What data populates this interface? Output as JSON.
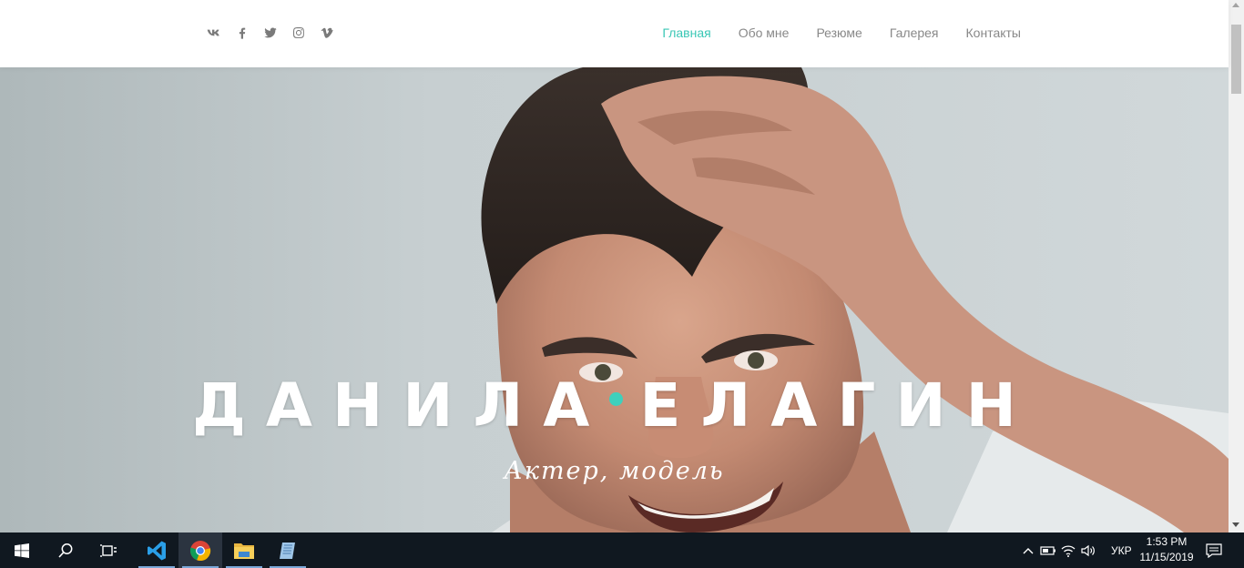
{
  "header": {
    "socials": [
      {
        "icon": "vk-icon",
        "label": "vk"
      },
      {
        "icon": "facebook-icon",
        "label": "f"
      },
      {
        "icon": "twitter-icon",
        "label": "twitter"
      },
      {
        "icon": "instagram-icon",
        "label": "instagram"
      },
      {
        "icon": "vimeo-icon",
        "label": "vimeo"
      }
    ],
    "nav": [
      {
        "label": "Главная",
        "active": true
      },
      {
        "label": "Обо мне",
        "active": false
      },
      {
        "label": "Резюме",
        "active": false
      },
      {
        "label": "Галерея",
        "active": false
      },
      {
        "label": "Контакты",
        "active": false
      }
    ]
  },
  "hero": {
    "first_name": "ДАНИЛА",
    "last_name": "ЕЛАГИН",
    "subtitle": "Актер, модель"
  },
  "colors": {
    "accent": "#3ac7b5",
    "nav_text": "#888888",
    "taskbar": "#101820"
  },
  "taskbar": {
    "apps": [
      "start-icon",
      "search-icon",
      "task-view-icon",
      "vscode-icon",
      "chrome-icon",
      "file-explorer-icon",
      "notepad-icon"
    ],
    "language": "УКР",
    "time": "1:53 PM",
    "date": "11/15/2019"
  }
}
